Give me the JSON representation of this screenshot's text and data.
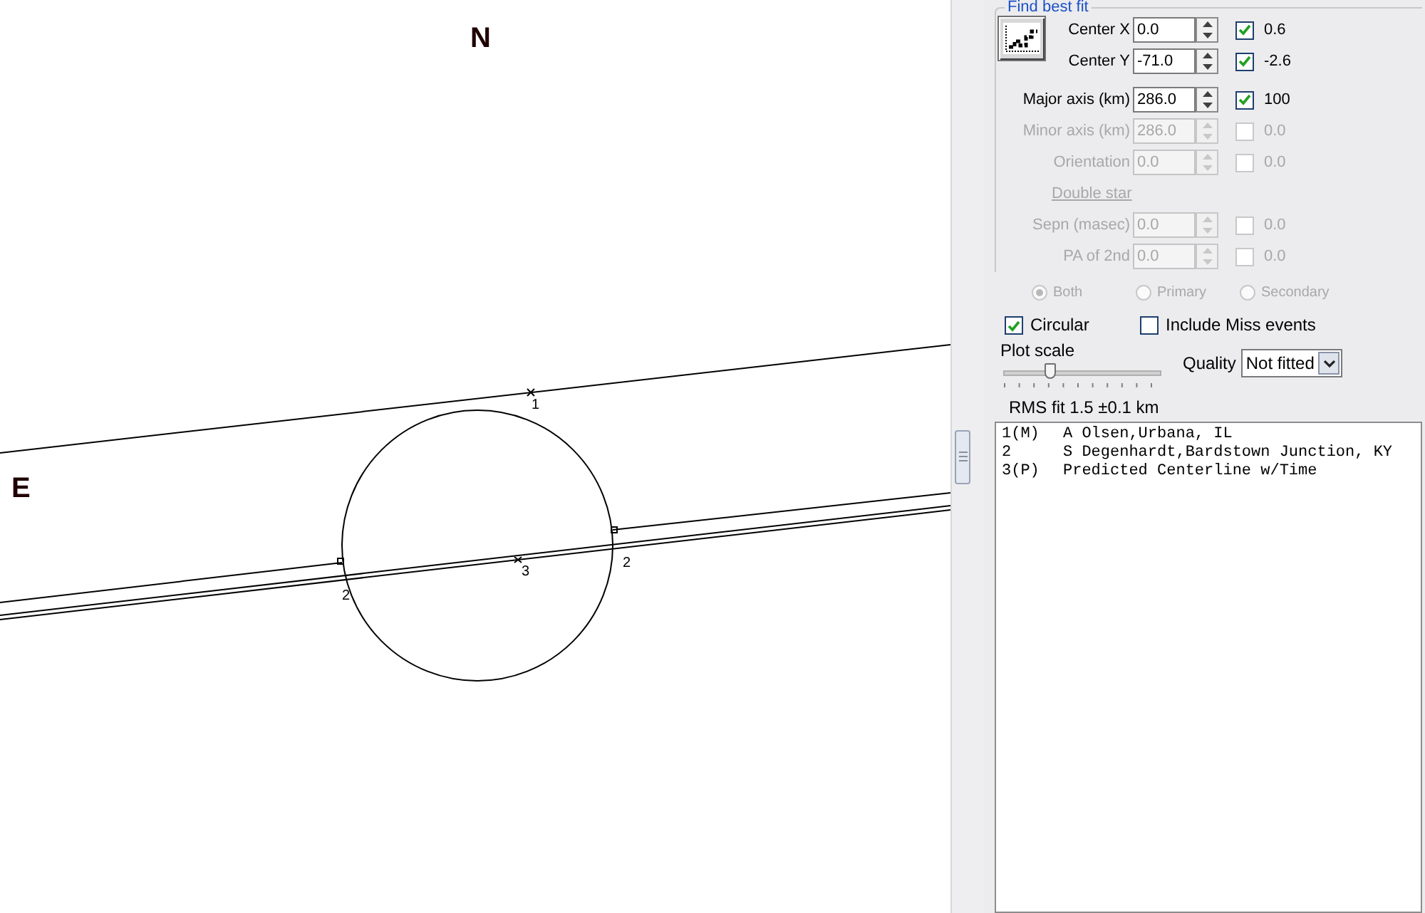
{
  "plot": {
    "compass": [
      {
        "label": "N"
      },
      {
        "label": "E"
      }
    ],
    "chord_labels": [
      "1",
      "2",
      "2",
      "3"
    ]
  },
  "fit_panel": {
    "title": "Find best fit",
    "params": [
      {
        "label": "Center X",
        "value": "0.0",
        "disabled": false,
        "fit_checked": true,
        "delta": "0.6"
      },
      {
        "label": "Center Y",
        "value": "-71.0",
        "disabled": false,
        "fit_checked": true,
        "delta": "-2.6"
      },
      {
        "label": "Major axis (km)",
        "value": "286.0",
        "disabled": false,
        "fit_checked": true,
        "delta": "100"
      },
      {
        "label": "Minor axis (km)",
        "value": "286.0",
        "disabled": true,
        "fit_checked": false,
        "delta": "0.0"
      },
      {
        "label": "Orientation",
        "value": "0.0",
        "disabled": true,
        "fit_checked": false,
        "delta": "0.0"
      }
    ],
    "double_star": {
      "label": "Double star",
      "disabled": true,
      "params": [
        {
          "label": "Sepn (masec)",
          "value": "0.0",
          "disabled": true,
          "fit_checked": false,
          "delta": "0.0"
        },
        {
          "label": "PA of 2nd",
          "value": "0.0",
          "disabled": true,
          "fit_checked": false,
          "delta": "0.0"
        }
      ],
      "radios": [
        {
          "label": "Both",
          "selected": true
        },
        {
          "label": "Primary",
          "selected": false
        },
        {
          "label": "Secondary",
          "selected": false
        }
      ]
    },
    "options": [
      {
        "label": "Circular",
        "checked": true
      },
      {
        "label": "Include Miss events",
        "checked": false
      }
    ],
    "plot_scale": {
      "label": "Plot scale",
      "level": 0.3
    },
    "quality": {
      "label": "Quality",
      "value": "Not fitted"
    },
    "rms": "RMS fit 1.5 ±0.1 km",
    "observers": [
      {
        "index": "1(M)",
        "text": "A Olsen,Urbana, IL"
      },
      {
        "index": "2",
        "text": "S Degenhardt,Bardstown Junction, KY"
      },
      {
        "index": "3(P)",
        "text": "Predicted Centerline w/Time"
      }
    ]
  }
}
